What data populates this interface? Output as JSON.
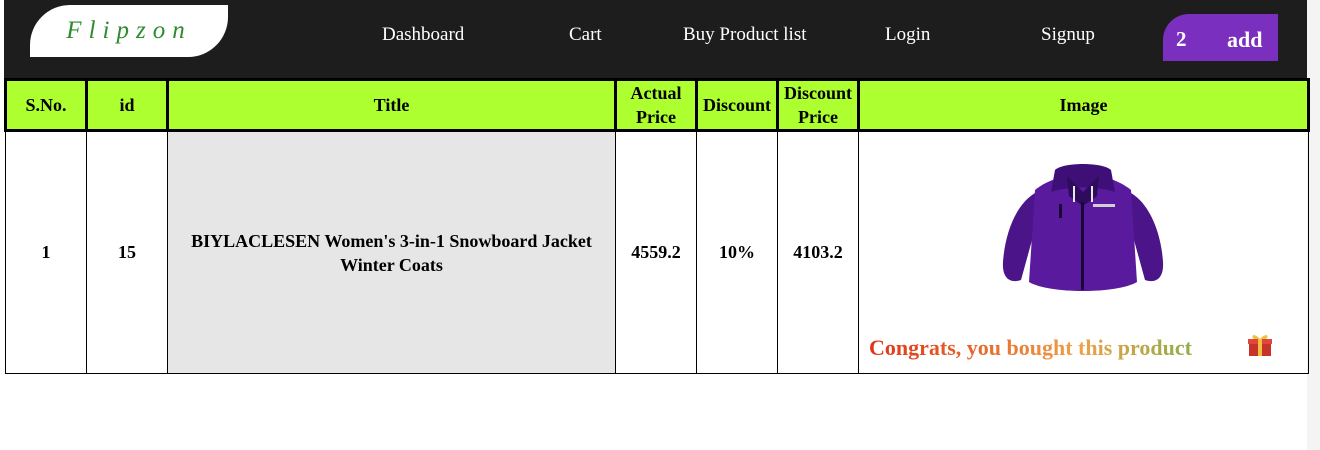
{
  "brand": {
    "logo_text": "Flipzon"
  },
  "nav": {
    "dashboard": "Dashboard",
    "cart": "Cart",
    "buy_list": "Buy Product list",
    "login": "Login",
    "signup": "Signup"
  },
  "cart_button": {
    "count": "2",
    "label": "add"
  },
  "table": {
    "headers": [
      "S.No.",
      "id",
      "Title",
      "Actual Price",
      "Discount",
      "Discount Price",
      "Image"
    ],
    "rows": [
      {
        "sno": "1",
        "id": "15",
        "title": "BIYLACLESEN Women's 3-in-1 Snowboard Jacket Winter Coats",
        "actual_price": "4559.2",
        "discount": "10%",
        "discount_price": "4103.2",
        "image_icon": "purple-jacket-image",
        "message": "Congrats, you bought this product",
        "message_icon": "gift-icon"
      }
    ]
  },
  "colors": {
    "navbar_bg": "#1d1d1d",
    "header_bg": "#adff2f",
    "accent_purple": "#7b2fbe",
    "logo_green": "#2e8b2e",
    "title_cell_bg": "#e6e6e6"
  }
}
